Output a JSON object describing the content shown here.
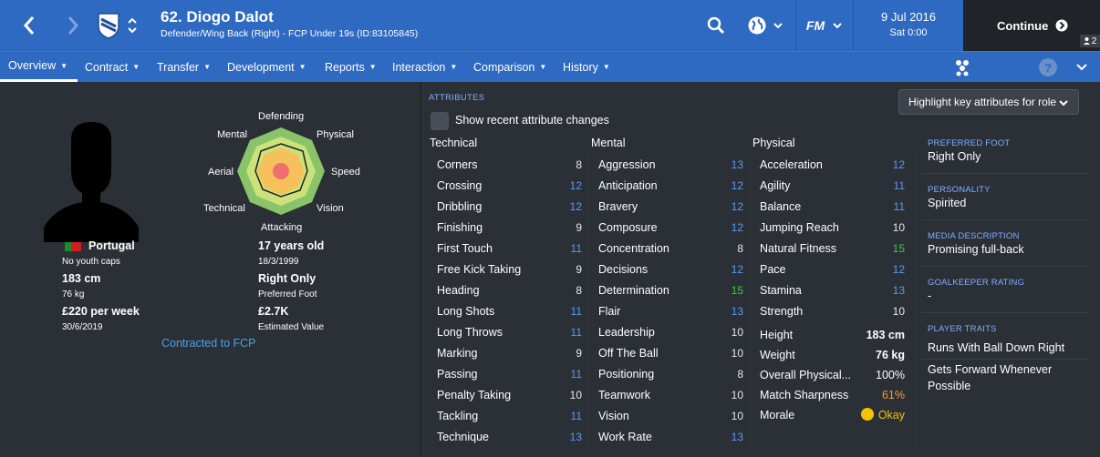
{
  "header": {
    "title": "62. Diogo Dalot",
    "subtitle": "Defender/Wing Back (Right) - FCP Under 19s (ID:83105845)",
    "date": "9 Jul 2016",
    "time": "Sat 0:00",
    "continue_label": "Continue",
    "notification_count": "2"
  },
  "nav": {
    "items": [
      {
        "label": "Overview"
      },
      {
        "label": "Contract"
      },
      {
        "label": "Transfer"
      },
      {
        "label": "Development"
      },
      {
        "label": "Reports"
      },
      {
        "label": "Interaction"
      },
      {
        "label": "Comparison"
      },
      {
        "label": "History"
      }
    ],
    "help": "?"
  },
  "profile": {
    "nationality": "Portugal",
    "caps": "No youth caps",
    "height": "183 cm",
    "weight": "76 kg",
    "wage": "£220 per week",
    "contract_end": "30/6/2019",
    "age": "17 years old",
    "dob": "18/3/1999",
    "foot": "Right Only",
    "foot_label": "Preferred Foot",
    "value": "£2.7K",
    "value_label": "Estimated Value",
    "contract_link": "Contracted to FCP"
  },
  "radar": {
    "labels": {
      "defending": "Defending",
      "physical": "Physical",
      "speed": "Speed",
      "vision": "Vision",
      "attacking": "Attacking",
      "technical": "Technical",
      "aerial": "Aerial",
      "mental": "Mental"
    }
  },
  "attributes": {
    "section_label": "ATTRIBUTES",
    "recent_changes_label": "Show recent attribute changes",
    "highlight_label": "Highlight key attributes for role",
    "technical_head": "Technical",
    "mental_head": "Mental",
    "physical_head": "Physical",
    "technical": [
      {
        "name": "Corners",
        "value": "8",
        "tone": "white"
      },
      {
        "name": "Crossing",
        "value": "12",
        "tone": "blue"
      },
      {
        "name": "Dribbling",
        "value": "12",
        "tone": "blue"
      },
      {
        "name": "Finishing",
        "value": "9",
        "tone": "white"
      },
      {
        "name": "First Touch",
        "value": "11",
        "tone": "blue"
      },
      {
        "name": "Free Kick Taking",
        "value": "9",
        "tone": "white"
      },
      {
        "name": "Heading",
        "value": "8",
        "tone": "white"
      },
      {
        "name": "Long Shots",
        "value": "11",
        "tone": "blue"
      },
      {
        "name": "Long Throws",
        "value": "11",
        "tone": "blue"
      },
      {
        "name": "Marking",
        "value": "9",
        "tone": "white"
      },
      {
        "name": "Passing",
        "value": "11",
        "tone": "blue"
      },
      {
        "name": "Penalty Taking",
        "value": "10",
        "tone": "white"
      },
      {
        "name": "Tackling",
        "value": "11",
        "tone": "blue"
      },
      {
        "name": "Technique",
        "value": "13",
        "tone": "blue"
      }
    ],
    "mental": [
      {
        "name": "Aggression",
        "value": "13",
        "tone": "blue"
      },
      {
        "name": "Anticipation",
        "value": "12",
        "tone": "blue"
      },
      {
        "name": "Bravery",
        "value": "12",
        "tone": "blue"
      },
      {
        "name": "Composure",
        "value": "12",
        "tone": "blue"
      },
      {
        "name": "Concentration",
        "value": "8",
        "tone": "white"
      },
      {
        "name": "Decisions",
        "value": "12",
        "tone": "blue"
      },
      {
        "name": "Determination",
        "value": "15",
        "tone": "green"
      },
      {
        "name": "Flair",
        "value": "13",
        "tone": "blue"
      },
      {
        "name": "Leadership",
        "value": "10",
        "tone": "white"
      },
      {
        "name": "Off The Ball",
        "value": "10",
        "tone": "white"
      },
      {
        "name": "Positioning",
        "value": "8",
        "tone": "white"
      },
      {
        "name": "Teamwork",
        "value": "10",
        "tone": "white"
      },
      {
        "name": "Vision",
        "value": "10",
        "tone": "white"
      },
      {
        "name": "Work Rate",
        "value": "13",
        "tone": "blue"
      }
    ],
    "physical": [
      {
        "name": "Acceleration",
        "value": "12",
        "tone": "blue"
      },
      {
        "name": "Agility",
        "value": "11",
        "tone": "blue"
      },
      {
        "name": "Balance",
        "value": "11",
        "tone": "blue"
      },
      {
        "name": "Jumping Reach",
        "value": "10",
        "tone": "white"
      },
      {
        "name": "Natural Fitness",
        "value": "15",
        "tone": "green"
      },
      {
        "name": "Pace",
        "value": "12",
        "tone": "blue"
      },
      {
        "name": "Stamina",
        "value": "13",
        "tone": "blue"
      },
      {
        "name": "Strength",
        "value": "10",
        "tone": "white"
      }
    ],
    "condition": [
      {
        "name": "Height",
        "value": "183 cm"
      },
      {
        "name": "Weight",
        "value": "76 kg"
      },
      {
        "name": "Overall Physical...",
        "value": "100%"
      },
      {
        "name": "Match Sharpness",
        "value": "61%"
      },
      {
        "name": "Morale",
        "value": "Okay"
      }
    ]
  },
  "sidebar": {
    "foot_h": "PREFERRED FOOT",
    "foot_v": "Right Only",
    "personality_h": "PERSONALITY",
    "personality_v": "Spirited",
    "media_h": "MEDIA DESCRIPTION",
    "media_v": "Promising full-back",
    "gk_h": "GOALKEEPER RATING",
    "gk_v": "-",
    "traits_h": "PLAYER TRAITS",
    "trait1": "Runs With Ball Down Right",
    "trait2a": "Gets Forward Whenever",
    "trait2b": "Possible"
  },
  "colors": {
    "header_blue": "#2e69c2",
    "attr_blue": "#5a9bf0",
    "attr_green": "#3fcc3f",
    "sharpness_orange": "#f0a030",
    "morale_yellow": "#f5c400"
  }
}
